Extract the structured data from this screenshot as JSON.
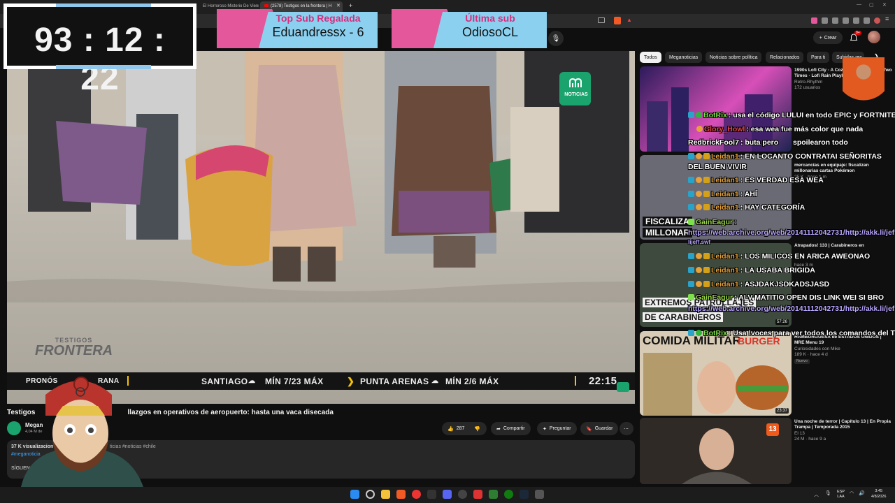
{
  "browser": {
    "tabs": [
      "El Horroroso Misterio De Vienn",
      "(2578) Testigos en la frontera | H"
    ],
    "close_glyph": "✕",
    "new_tab_glyph": "+"
  },
  "youtube": {
    "create_label": "Crear",
    "notif_count": "9+",
    "chips": [
      "Todos",
      "Meganoticias",
      "Noticias sobre política",
      "Relacionados",
      "Para ti",
      "Subidas rec"
    ]
  },
  "overlay": {
    "timer": "93 : 12 : 22",
    "banner1_title": "Top Sub Regalada",
    "banner1_name": "Eduandressx - 6",
    "banner2_title": "Última sub",
    "banner2_name": "OdiosoCL"
  },
  "video": {
    "channel_logo_label": "NOTICIAS",
    "show_logo_line1": "TESTIGOS",
    "show_logo_line2": "FRONTERA",
    "ticker_left": "PRONÓS",
    "ticker_left2": "RANA",
    "ticker_city1": "SANTIAGO",
    "ticker_range1": "MÍN 7/23 MÁX",
    "ticker_city2": "PUNTA ARENAS",
    "ticker_range2": "MÍN 2/6 MÁX",
    "ticker_time": "22:15"
  },
  "watch": {
    "title_start": "Testigos",
    "title_end": "llazgos en operativos de aeropuerto: hasta una vaca disecada",
    "channel_short": "Megan",
    "subs_short": "4,04 M de",
    "likes": "287",
    "share_label": "Compartir",
    "ask_label": "Preguntar",
    "save_label": "Guardar",
    "views": "37 K visualizacion",
    "tags_end": "ticias #noticias #chile",
    "hashtag": "#meganoticia",
    "follow_text": "SÍGUENOS E"
  },
  "recommendations": [
    {
      "title": "1990s Lofi City",
      "title2": "A Cozy Balcon Between Two Times",
      "title3": "Lofi Rain Playlist",
      "channel": "Retro-Rhythm",
      "meta": "172 usuarios"
    },
    {
      "title": "mercancías en equipaje: fiscalizan millonarias cartas Pokémon",
      "meta": "25 K · hace 1 m",
      "thumb_text": "FISCALIZA",
      "thumb_text2": "MILLONAR"
    },
    {
      "title": "Atrapados! 133 | Carabineros en",
      "meta": "hace 3 m",
      "thumb_text": "EXTREMOS PATRULLAJES",
      "thumb_text2": "DE CARABINEROS",
      "duration": "57:26"
    },
    {
      "title": "HAMBURGUESA de ESTADOS UNIDOS | MRE Menu 19",
      "channel": "Curiosidades con Mike",
      "meta": "189 K · hace 4 d",
      "badge": "Nuevo",
      "thumb_text": "COMIDA MILITAR",
      "thumb_text2": "BURGER",
      "duration": "23:37"
    },
    {
      "title": "Una noche de terror | Capítulo 13 | En Propia Trampa | Temporada 2015",
      "channel": "El 13",
      "meta": "24 M · hace 9 a",
      "channel_badge": "13"
    }
  ],
  "chat": [
    {
      "user": "BotRix",
      "color": "#7ee04a",
      "text": ": usa el código LULUI en todo EPIC y FORTNITE"
    },
    {
      "user": "Glory_Howl",
      "color": "#e64a4a",
      "text": ": esa wea fue más color que nada"
    },
    {
      "user": "RedbrickFool7",
      "color": "#f1f1f1",
      "text": ": buta pero",
      "extra": "spoilearon todo"
    },
    {
      "user": "Leidan1",
      "color": "#e8a23a",
      "text": ": EN LOCANTO CONTRATAI SEÑORITAS DEL BUEN VIVIR"
    },
    {
      "user": "Leidan1",
      "color": "#e8a23a",
      "text": ": ES VERDAD ESA WEA"
    },
    {
      "user": "Leidan1",
      "color": "#e8a23a",
      "text": ": AHÍ"
    },
    {
      "user": "Leidan1",
      "color": "#e8a23a",
      "text": ": HAY CATEGORÍA"
    },
    {
      "user": "GainEagur",
      "color": "#9cd64a",
      "text": ": https://web.archive.org/web/20141112042731/http://akk.li/jef"
    },
    {
      "user": "Leidan1",
      "color": "#e8a23a",
      "text": ": LOS MILICOS EN ARICA AWEONAO"
    },
    {
      "user": "Leidan1",
      "color": "#e8a23a",
      "text": ": LA USABA BRIGIDA"
    },
    {
      "user": "Leidan1",
      "color": "#e8a23a",
      "text": ": ASJDAKJSDKADSJASD"
    },
    {
      "user": "GainEagur",
      "color": "#9cd64a",
      "text": ": ALV MATITIO OPEN DIS LINK WEI SI BRO"
    },
    {
      "user": "",
      "color": "#f1f1f1",
      "text": "https://web.archive.org/web/20141112042731/http://akk.li/jef"
    },
    {
      "user": "BotRix",
      "color": "#7ee04a",
      "text": ": Usa !voces para ver todos los comandos del TTS"
    }
  ],
  "chat_extra_link": "lijeff.swf",
  "taskbar": {
    "lang1": "ESP",
    "lang2": "LAA",
    "time": "3:45",
    "date": "4/8/2026"
  }
}
